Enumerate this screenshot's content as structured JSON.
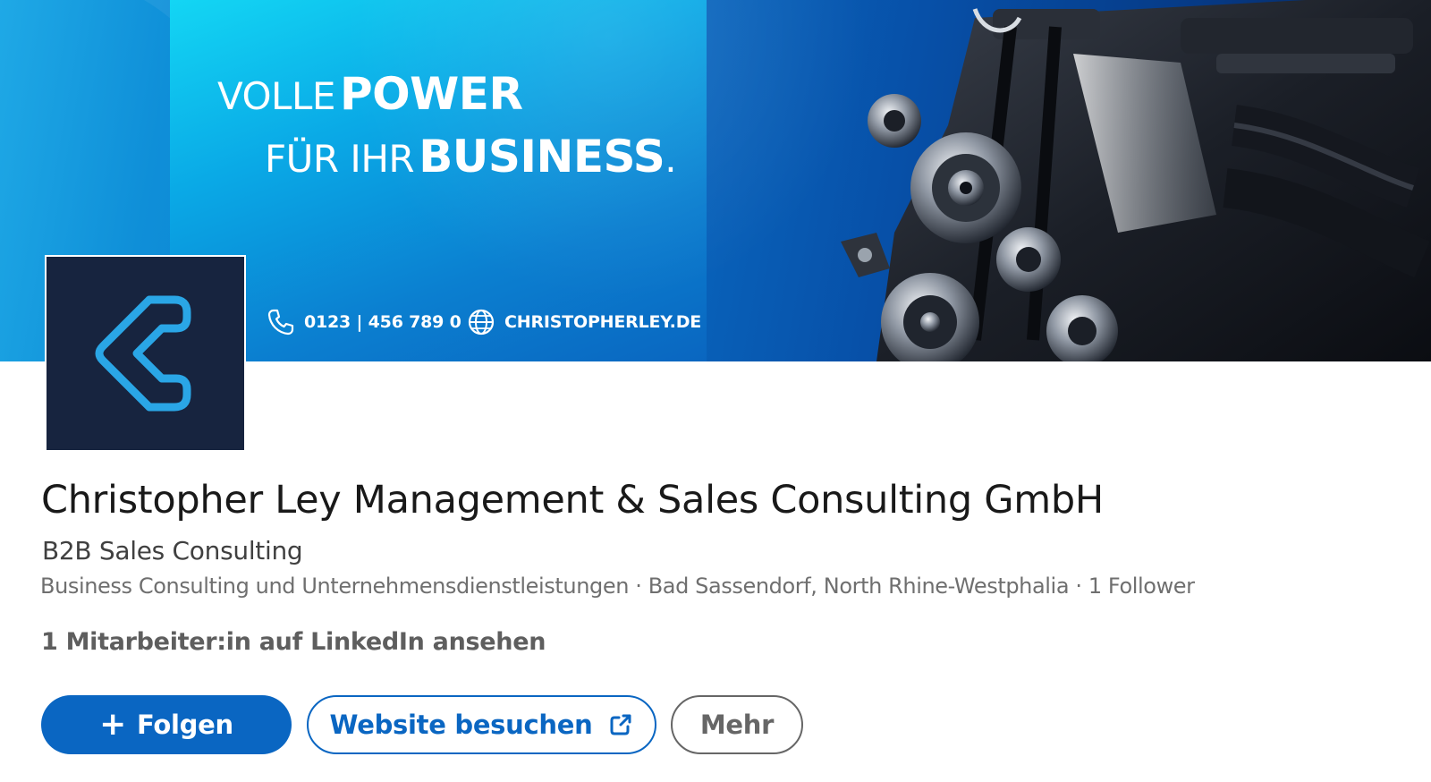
{
  "banner": {
    "headline_line1_light": "VOLLE",
    "headline_line1_bold": "POWER",
    "headline_line2_light": "FÜR IHR",
    "headline_line2_bold": "BUSINESS",
    "headline_line2_period": ".",
    "phone": "0123 | 456 789 0",
    "website": "CHRISTOPHERLEY.DE",
    "phone_icon": "phone-icon",
    "globe_icon": "globe-icon"
  },
  "company": {
    "name": "Christopher Ley Management & Sales Consulting GmbH",
    "tagline": "B2B Sales Consulting",
    "meta": "Business Consulting und Unternehmensdienstleistungen · Bad Sassendorf, North Rhine-Westphalia · 1 Follower",
    "employees_link": "1 Mitarbeiter:in auf LinkedIn ansehen"
  },
  "actions": {
    "follow_icon": "+",
    "follow_label": "Folgen",
    "website_label": "Website besuchen",
    "website_icon": "external-link-icon",
    "more_label": "Mehr"
  },
  "colors": {
    "brand_blue": "#0a66c2",
    "logo_bg": "#17243f",
    "logo_accent": "#2aa6e6"
  }
}
